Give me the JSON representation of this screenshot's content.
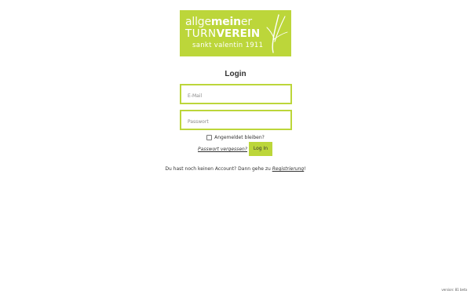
{
  "logo": {
    "line1_light": "allge",
    "line1_bold": "mein",
    "line1_end": "er",
    "line2_light": "TURN",
    "line2_bold": "VEREIN",
    "line3": "sankt valentin 1911",
    "bg_color": "#bcd63a"
  },
  "login": {
    "title": "Login",
    "email_placeholder": "E-Mail",
    "password_placeholder": "Passwort",
    "remember_label": "Angemeldet bleiben?",
    "forgot_link": "Passwort vergessen?",
    "login_button": "Log In"
  },
  "register": {
    "text": "Du hast noch keinen Account? Dann gehe zu ",
    "link": "Registrierung",
    "suffix": "!"
  },
  "footer": {
    "version": "version: 81 beta"
  },
  "colors": {
    "accent": "#bcd63a",
    "text": "#333333"
  }
}
